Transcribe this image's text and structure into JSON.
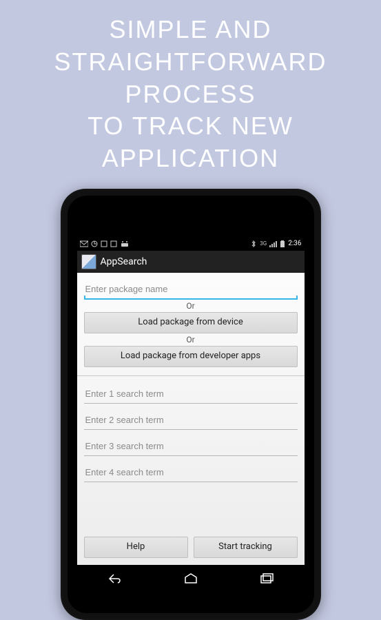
{
  "promo": {
    "line1": "SIMPLE AND",
    "line2": "STRAIGHTFORWARD PROCESS",
    "line3": "TO TRACK NEW APPLICATION"
  },
  "statusBar": {
    "time": "2:36",
    "dataLabel": "3G"
  },
  "actionBar": {
    "title": "AppSearch"
  },
  "form": {
    "packagePlaceholder": "Enter package name",
    "or": "Or",
    "loadFromDevice": "Load package from device",
    "loadFromDev": "Load package from developer apps",
    "search1": "Enter 1 search term",
    "search2": "Enter 2 search term",
    "search3": "Enter 3 search term",
    "search4": "Enter 4 search term",
    "help": "Help",
    "start": "Start tracking"
  }
}
